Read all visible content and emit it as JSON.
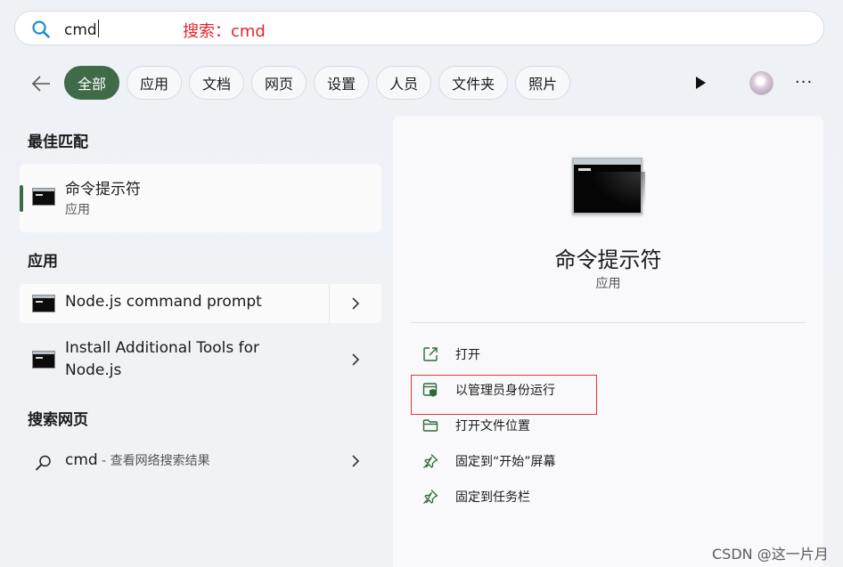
{
  "search": {
    "query": "cmd",
    "annotation": "搜索：cmd"
  },
  "filters": {
    "chips": [
      "全部",
      "应用",
      "文档",
      "网页",
      "设置",
      "人员",
      "文件夹",
      "照片"
    ],
    "active_index": 0
  },
  "best_match": {
    "heading": "最佳匹配",
    "title": "命令提示符",
    "subtitle": "应用"
  },
  "apps": {
    "heading": "应用",
    "items": [
      {
        "title": "Node.js command prompt"
      },
      {
        "title_line1": "Install Additional Tools for",
        "title_line2": "Node.js"
      }
    ]
  },
  "web": {
    "heading": "搜索网页",
    "query": "cmd",
    "suffix": " - 查看网络搜索结果"
  },
  "detail": {
    "title": "命令提示符",
    "subtitle": "应用",
    "actions": [
      {
        "label": "打开",
        "icon": "open-external-icon"
      },
      {
        "label": "以管理员身份运行",
        "icon": "shield-admin-icon"
      },
      {
        "label": "打开文件位置",
        "icon": "folder-icon"
      },
      {
        "label": "固定到“开始”屏幕",
        "icon": "pin-icon"
      },
      {
        "label": "固定到任务栏",
        "icon": "pin-icon"
      }
    ]
  },
  "watermark": "CSDN @这一片月",
  "colors": {
    "accent": "#3f6b48",
    "annotation_red": "#e0262a"
  }
}
